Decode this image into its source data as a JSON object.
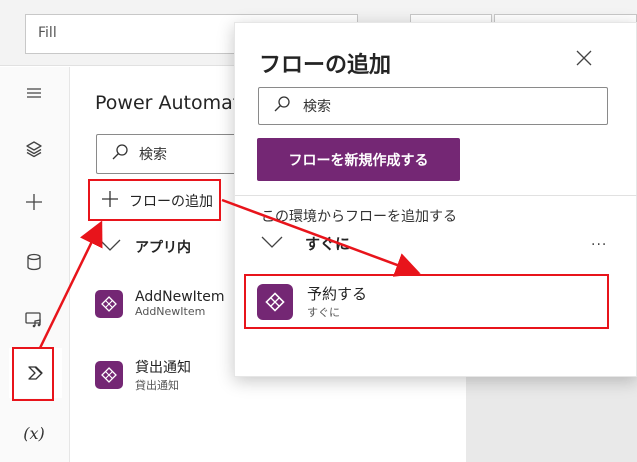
{
  "formula_bar": {
    "value": "Fill"
  },
  "panel": {
    "title": "Power Automate",
    "search_placeholder": "検索",
    "add_flow_label": "フローの追加",
    "section_label": "アプリ内",
    "items": [
      {
        "name": "AddNewItem",
        "sub": "AddNewItem"
      },
      {
        "name": "貸出通知",
        "sub": "貸出通知"
      }
    ]
  },
  "popup": {
    "title": "フローの追加",
    "search_placeholder": "検索",
    "new_flow_button": "フローを新規作成する",
    "env_label": "この環境からフローを追加する",
    "section_label": "すぐに",
    "more_label": "···",
    "item": {
      "name": "予約する",
      "sub": "すぐに"
    }
  },
  "rail": {
    "variables_label": "(x)"
  },
  "colors": {
    "accent": "#742774",
    "highlight": "#e8141b"
  },
  "icons": {
    "rail": [
      "hamburger-icon",
      "layers-icon",
      "plus-icon",
      "database-icon",
      "media-icon",
      "power-automate-icon",
      "variables-icon"
    ],
    "search": "search-icon",
    "close": "close-icon",
    "chevron": "chevron-down-icon",
    "flow": "flow-icon"
  }
}
